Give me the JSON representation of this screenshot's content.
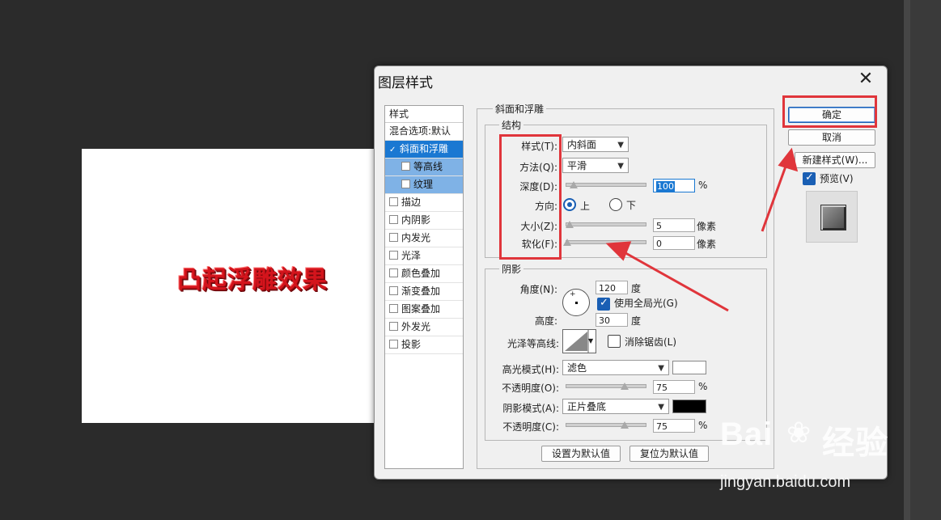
{
  "canvas": {
    "text": "凸起浮雕效果"
  },
  "dialog": {
    "title": "图层样式",
    "close_glyph": "✕",
    "style_list": {
      "header": "样式",
      "items": [
        "混合选项:默认",
        "斜面和浮雕",
        "等高线",
        "纹理",
        "描边",
        "内阴影",
        "内发光",
        "光泽",
        "颜色叠加",
        "渐变叠加",
        "图案叠加",
        "外发光",
        "投影"
      ],
      "selected_check": "✓"
    },
    "bevel": {
      "group_title": "斜面和浮雕",
      "structure_title": "结构",
      "style_label": "样式(T):",
      "style_value": "内斜面",
      "method_label": "方法(Q):",
      "method_value": "平滑",
      "depth_label": "深度(D):",
      "depth_value": "100",
      "depth_unit": "%",
      "direction_label": "方向:",
      "dir_up": "上",
      "dir_down": "下",
      "size_label": "大小(Z):",
      "size_value": "5",
      "size_unit": "像素",
      "soften_label": "软化(F):",
      "soften_value": "0",
      "soften_unit": "像素"
    },
    "shading": {
      "group_title": "阴影",
      "angle_label": "角度(N):",
      "angle_value": "120",
      "angle_unit": "度",
      "global_light": "使用全局光(G)",
      "altitude_label": "高度:",
      "altitude_value": "30",
      "altitude_unit": "度",
      "gloss_label": "光泽等高线:",
      "antialias": "消除锯齿(L)",
      "highlight_label": "高光模式(H):",
      "highlight_value": "滤色",
      "highlight_color": "#ffffff",
      "opacity1_label": "不透明度(O):",
      "opacity1_value": "75",
      "opacity1_unit": "%",
      "shadow_label": "阴影模式(A):",
      "shadow_value": "正片叠底",
      "shadow_color": "#000000",
      "opacity2_label": "不透明度(C):",
      "opacity2_value": "75",
      "opacity2_unit": "%"
    },
    "buttons": {
      "make_default": "设置为默认值",
      "reset_default": "复位为默认值",
      "ok": "确定",
      "cancel": "取消",
      "new_style": "新建样式(W)...",
      "preview": "预览(V)"
    }
  },
  "watermark": {
    "logo": "Bai",
    "logo_suffix": "经验",
    "url": "jingyan.baidu.com"
  },
  "colors": {
    "accent": "#1a78d2",
    "annotation": "#e0353b"
  }
}
